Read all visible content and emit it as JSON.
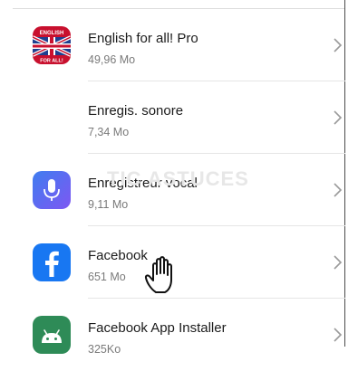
{
  "apps": [
    {
      "name": "English for all! Pro",
      "size": "49,96 Mo",
      "icon": "english-flag-icon",
      "icon_text_top": "ENGLISH",
      "icon_text_bottom": "FOR ALL!"
    },
    {
      "name": "Enregis. sonore",
      "size": "7,34 Mo",
      "icon": "sound-wave-icon"
    },
    {
      "name": "Enregistreur vocal",
      "size": "9,11 Mo",
      "icon": "microphone-icon"
    },
    {
      "name": "Facebook",
      "size": "651 Mo",
      "icon": "facebook-icon"
    },
    {
      "name": "Facebook App Installer",
      "size": "325Ko",
      "icon": "android-icon"
    }
  ],
  "watermark": "TIC ASTUCES",
  "colors": {
    "facebook": "#1877f2",
    "installer": "#2e8b57",
    "mic_start": "#3f7df0",
    "mic_end": "#7e57f2"
  }
}
